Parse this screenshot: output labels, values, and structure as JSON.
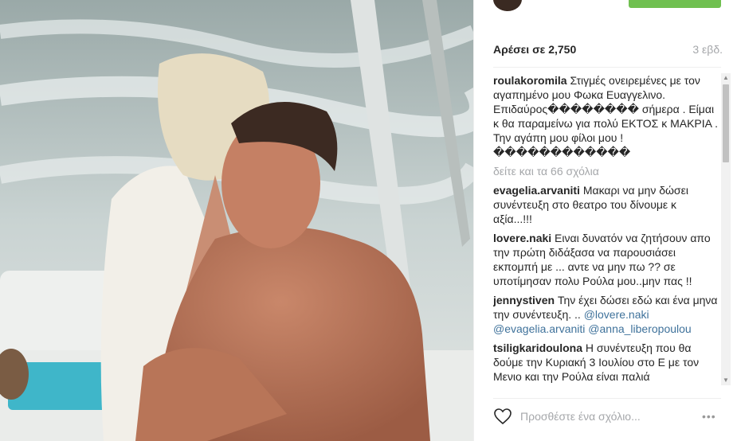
{
  "header": {
    "avatar": "profile-avatar",
    "follow_button_color": "#70c050"
  },
  "likes": {
    "text": "Αρέσει σε 2,750",
    "time": "3 εβδ."
  },
  "caption": {
    "user": "roulakoromila",
    "text": "Στιγμές ονειρεμένες με τον αγαπημένο μου Φωκα Ευαγγελινο. Επιδαύρος�������� σήμερα . Είμαι κ θα παραμείνω για πολύ ΕΚΤΟΣ κ ΜΑΚΡΙΑ . Την αγάπη μου φίλοι μου ! ������������"
  },
  "view_all": "δείτε και τα 66 σχόλια",
  "comments": [
    {
      "user": "evagelia.arvaniti",
      "text": "Μακαρι να μην δώσει συνέντευξη στο θεατρο του δίνουμε κ αξία...!!!"
    },
    {
      "user": "lovere.naki",
      "text": "Ειναι δυνατόν να ζητήσουν απο την πρώτη διδάξασα να παρουσιάσει εκπομπή με ... αντε να μην πω ?? σε υποτίμησαν πολυ Ρούλα μου..μην πας !!"
    },
    {
      "user": "jennystiven",
      "text": "Την έχει δώσει εδώ και ένα μηνα την συνέντευξη. .. ",
      "mentions": [
        "@lovere.naki",
        "@evagelia.arvaniti",
        "@anna_liberopoulou"
      ]
    },
    {
      "user": "tsiligkaridoulona",
      "text": "Η συνέντευξη που θα δούμε την Κυριακή 3 Ιουλίου στο Ε με τον Μενιο και την Ρούλα είναι παλιά"
    }
  ],
  "add_comment": {
    "placeholder": "Προσθέστε ένα σχόλιο..."
  },
  "options": "•••"
}
